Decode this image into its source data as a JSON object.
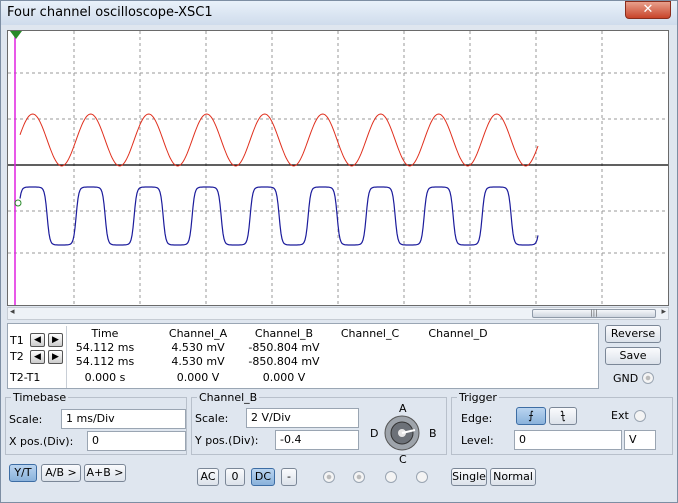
{
  "window": {
    "title": "Four channel oscilloscope-XSC1",
    "close_glyph": "✕"
  },
  "scope": {
    "colors": {
      "channel_a": "#e0301e",
      "channel_b": "#1c1c9c",
      "cursor": "#e020e0",
      "axis": "#000000",
      "grid": "#9a9a9a"
    }
  },
  "scrollbar": {
    "left_glyph": "◂",
    "right_glyph": "▸",
    "grip": "|||"
  },
  "readout": {
    "t1_label": "T1",
    "t2_label": "T2",
    "diff_label": "T2-T1",
    "nav_left": "◀",
    "nav_right": "▶",
    "headers": [
      "Time",
      "Channel_A",
      "Channel_B",
      "Channel_C",
      "Channel_D"
    ],
    "row_t1": [
      "54.112 ms",
      "4.530 mV",
      "-850.804 mV"
    ],
    "row_t2": [
      "54.112 ms",
      "4.530 mV",
      "-850.804 mV"
    ],
    "row_diff": [
      "0.000 s",
      "0.000 V",
      "0.000 V"
    ]
  },
  "side": {
    "reverse": "Reverse",
    "save": "Save",
    "gnd": "GND"
  },
  "timebase": {
    "title": "Timebase",
    "scale_label": "Scale:",
    "scale_value": "1 ms/Div",
    "xpos_label": "X pos.(Div):",
    "xpos_value": "0",
    "modes": [
      "Y/T",
      "A/B >",
      "A+B >"
    ]
  },
  "channel": {
    "title": "Channel_B",
    "scale_label": "Scale:",
    "scale_value": "2  V/Div",
    "ypos_label": "Y pos.(Div):",
    "ypos_value": "-0.4",
    "coupling": [
      "AC",
      "0",
      "DC",
      "-"
    ],
    "knob": {
      "a": "A",
      "b": "B",
      "c": "C",
      "d": "D"
    }
  },
  "trigger": {
    "title": "Trigger",
    "edge_label": "Edge:",
    "rise_glyph": "⨍",
    "fall_glyph": "⨍",
    "ext_label": "Ext",
    "level_label": "Level:",
    "level_value": "0",
    "level_unit": "V",
    "modes": [
      "Single",
      "Normal"
    ]
  }
}
